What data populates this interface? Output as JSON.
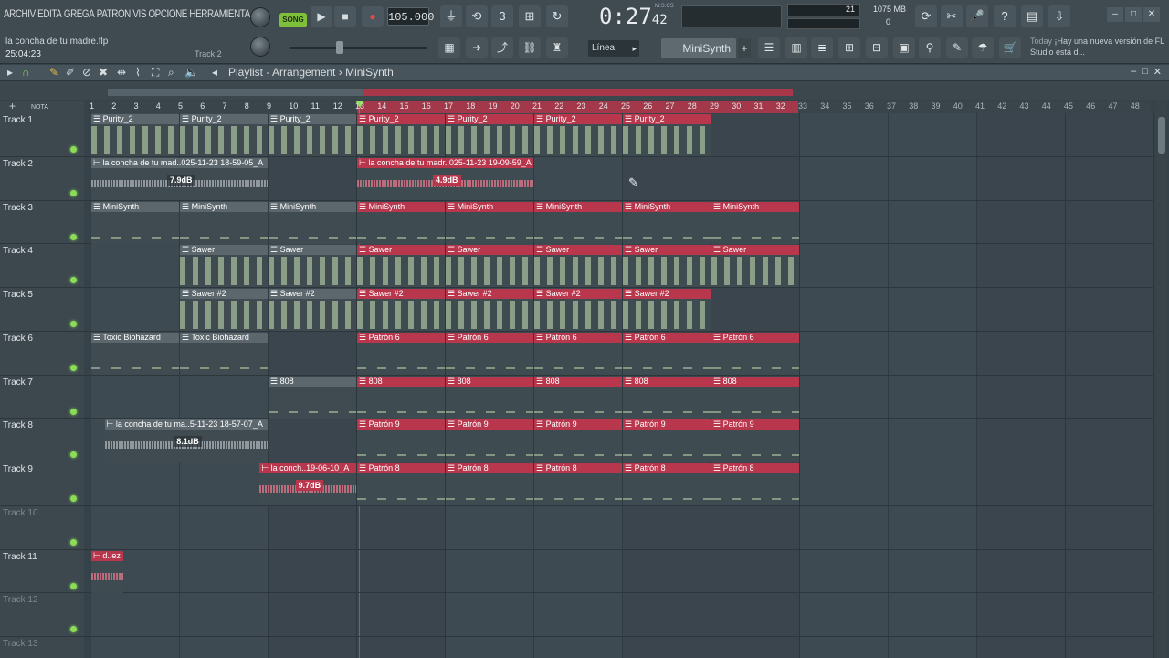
{
  "menu": [
    "ARCHIV",
    "EDITA",
    "GREGA",
    "PATRON",
    "VIS",
    "OPCIONE",
    "HERRAMIENTA"
  ],
  "project": {
    "name": "la concha de tu madre.flp",
    "elapsed": "25:04:23",
    "hint_track": "Track 2"
  },
  "transport": {
    "song_label": "SONG",
    "tempo": "105.000",
    "time_main": "0:27",
    "time_sub": "42",
    "time_unit": "M:S:CS"
  },
  "monitor": {
    "cpu": "21",
    "memory": "1075 MB",
    "polyphony": "0"
  },
  "toolbar": {
    "snap": "Línea",
    "channel": "MiniSynth",
    "add": "+"
  },
  "news": {
    "when": "Today",
    "text": "¡Hay una nueva versión de FL Studio está d..."
  },
  "playlist": {
    "title": "Playlist - Arrangement",
    "separator": "›",
    "pattern": "MiniSynth",
    "header_label": "NOTA"
  },
  "ruler": [
    1,
    2,
    3,
    4,
    5,
    6,
    7,
    8,
    9,
    10,
    11,
    12,
    13,
    14,
    15,
    16,
    17,
    18,
    19,
    20,
    21,
    22,
    23,
    24,
    25,
    26,
    27,
    28,
    29,
    30,
    31,
    32,
    33,
    34,
    35,
    36,
    37,
    38,
    39,
    40,
    41,
    42,
    43,
    44,
    45,
    46,
    47,
    48
  ],
  "tracks": [
    {
      "name": "Track 1",
      "active": true
    },
    {
      "name": "Track 2",
      "active": true
    },
    {
      "name": "Track 3",
      "active": true
    },
    {
      "name": "Track 4",
      "active": true
    },
    {
      "name": "Track 5",
      "active": true
    },
    {
      "name": "Track 6",
      "active": true
    },
    {
      "name": "Track 7",
      "active": true
    },
    {
      "name": "Track 8",
      "active": true
    },
    {
      "name": "Track 9",
      "active": true
    },
    {
      "name": "Track 10",
      "active": false
    },
    {
      "name": "Track 11",
      "active": true
    },
    {
      "name": "Track 12",
      "active": false
    },
    {
      "name": "Track 13",
      "active": false
    }
  ],
  "clips": [
    {
      "track": 1,
      "start": 1,
      "len": 4,
      "label": "Purity_2",
      "style": "grey",
      "kind": "notes"
    },
    {
      "track": 1,
      "start": 5,
      "len": 4,
      "label": "Purity_2",
      "style": "grey",
      "kind": "notes"
    },
    {
      "track": 1,
      "start": 9,
      "len": 4,
      "label": "Purity_2",
      "style": "grey",
      "kind": "notes"
    },
    {
      "track": 1,
      "start": 13,
      "len": 4,
      "label": "Purity_2",
      "style": "red",
      "kind": "notes"
    },
    {
      "track": 1,
      "start": 17,
      "len": 4,
      "label": "Purity_2",
      "style": "red",
      "kind": "notes"
    },
    {
      "track": 1,
      "start": 21,
      "len": 4,
      "label": "Purity_2",
      "style": "red",
      "kind": "notes"
    },
    {
      "track": 1,
      "start": 25,
      "len": 4,
      "label": "Purity_2",
      "style": "red",
      "kind": "notes"
    },
    {
      "track": 2,
      "start": 1,
      "len": 8,
      "label": "la concha de tu mad..025-11-23 18-59-05_A",
      "style": "grey",
      "kind": "audio",
      "gain": "7.9dB"
    },
    {
      "track": 2,
      "start": 13,
      "len": 8,
      "label": "la concha de tu madr..025-11-23 19-09-59_A",
      "style": "red",
      "kind": "audio",
      "gain": "4.9dB"
    },
    {
      "track": 3,
      "start": 1,
      "len": 4,
      "label": "MiniSynth",
      "style": "grey",
      "kind": "notes2"
    },
    {
      "track": 3,
      "start": 5,
      "len": 4,
      "label": "MiniSynth",
      "style": "grey",
      "kind": "notes2"
    },
    {
      "track": 3,
      "start": 9,
      "len": 4,
      "label": "MiniSynth",
      "style": "grey",
      "kind": "notes2"
    },
    {
      "track": 3,
      "start": 13,
      "len": 4,
      "label": "MiniSynth",
      "style": "red",
      "kind": "notes2"
    },
    {
      "track": 3,
      "start": 17,
      "len": 4,
      "label": "MiniSynth",
      "style": "red",
      "kind": "notes2"
    },
    {
      "track": 3,
      "start": 21,
      "len": 4,
      "label": "MiniSynth",
      "style": "red",
      "kind": "notes2"
    },
    {
      "track": 3,
      "start": 25,
      "len": 4,
      "label": "MiniSynth",
      "style": "red",
      "kind": "notes2"
    },
    {
      "track": 3,
      "start": 29,
      "len": 4,
      "label": "MiniSynth",
      "style": "red",
      "kind": "notes2"
    },
    {
      "track": 4,
      "start": 5,
      "len": 4,
      "label": "Sawer",
      "style": "grey",
      "kind": "notes"
    },
    {
      "track": 4,
      "start": 9,
      "len": 4,
      "label": "Sawer",
      "style": "grey",
      "kind": "notes"
    },
    {
      "track": 4,
      "start": 13,
      "len": 4,
      "label": "Sawer",
      "style": "red",
      "kind": "notes"
    },
    {
      "track": 4,
      "start": 17,
      "len": 4,
      "label": "Sawer",
      "style": "red",
      "kind": "notes"
    },
    {
      "track": 4,
      "start": 21,
      "len": 4,
      "label": "Sawer",
      "style": "red",
      "kind": "notes"
    },
    {
      "track": 4,
      "start": 25,
      "len": 4,
      "label": "Sawer",
      "style": "red",
      "kind": "notes"
    },
    {
      "track": 4,
      "start": 29,
      "len": 4,
      "label": "Sawer",
      "style": "red",
      "kind": "notes"
    },
    {
      "track": 5,
      "start": 5,
      "len": 4,
      "label": "Sawer #2",
      "style": "grey",
      "kind": "notes"
    },
    {
      "track": 5,
      "start": 9,
      "len": 4,
      "label": "Sawer #2",
      "style": "grey",
      "kind": "notes"
    },
    {
      "track": 5,
      "start": 13,
      "len": 4,
      "label": "Sawer #2",
      "style": "red",
      "kind": "notes"
    },
    {
      "track": 5,
      "start": 17,
      "len": 4,
      "label": "Sawer #2",
      "style": "red",
      "kind": "notes"
    },
    {
      "track": 5,
      "start": 21,
      "len": 4,
      "label": "Sawer #2",
      "style": "red",
      "kind": "notes"
    },
    {
      "track": 5,
      "start": 25,
      "len": 4,
      "label": "Sawer #2",
      "style": "red",
      "kind": "notes"
    },
    {
      "track": 6,
      "start": 1,
      "len": 4,
      "label": "Toxic Biohazard",
      "style": "grey",
      "kind": "notes2"
    },
    {
      "track": 6,
      "start": 5,
      "len": 4,
      "label": "Toxic Biohazard",
      "style": "grey",
      "kind": "notes2"
    },
    {
      "track": 6,
      "start": 13,
      "len": 4,
      "label": "Patrón 6",
      "style": "red",
      "kind": "notes2"
    },
    {
      "track": 6,
      "start": 17,
      "len": 4,
      "label": "Patrón 6",
      "style": "red",
      "kind": "notes2"
    },
    {
      "track": 6,
      "start": 21,
      "len": 4,
      "label": "Patrón 6",
      "style": "red",
      "kind": "notes2"
    },
    {
      "track": 6,
      "start": 25,
      "len": 4,
      "label": "Patrón 6",
      "style": "red",
      "kind": "notes2"
    },
    {
      "track": 6,
      "start": 29,
      "len": 4,
      "label": "Patrón 6",
      "style": "red",
      "kind": "notes2"
    },
    {
      "track": 7,
      "start": 9,
      "len": 4,
      "label": "808",
      "style": "grey",
      "kind": "notes2"
    },
    {
      "track": 7,
      "start": 13,
      "len": 4,
      "label": "808",
      "style": "red",
      "kind": "notes2"
    },
    {
      "track": 7,
      "start": 17,
      "len": 4,
      "label": "808",
      "style": "red",
      "kind": "notes2"
    },
    {
      "track": 7,
      "start": 21,
      "len": 4,
      "label": "808",
      "style": "red",
      "kind": "notes2"
    },
    {
      "track": 7,
      "start": 25,
      "len": 4,
      "label": "808",
      "style": "red",
      "kind": "notes2"
    },
    {
      "track": 7,
      "start": 29,
      "len": 4,
      "label": "808",
      "style": "red",
      "kind": "notes2"
    },
    {
      "track": 8,
      "start": 1.6,
      "len": 7.4,
      "label": "la concha de tu ma..5-11-23 18-57-07_A",
      "style": "grey",
      "kind": "audio",
      "gain": "8.1dB"
    },
    {
      "track": 8,
      "start": 13,
      "len": 4,
      "label": "Patrón 9",
      "style": "red",
      "kind": "notes2"
    },
    {
      "track": 8,
      "start": 17,
      "len": 4,
      "label": "Patrón 9",
      "style": "red",
      "kind": "notes2"
    },
    {
      "track": 8,
      "start": 21,
      "len": 4,
      "label": "Patrón 9",
      "style": "red",
      "kind": "notes2"
    },
    {
      "track": 8,
      "start": 25,
      "len": 4,
      "label": "Patrón 9",
      "style": "red",
      "kind": "notes2"
    },
    {
      "track": 8,
      "start": 29,
      "len": 4,
      "label": "Patrón 9",
      "style": "red",
      "kind": "notes2"
    },
    {
      "track": 9,
      "start": 8.6,
      "len": 4.4,
      "label": "la conch..19-06-10_A",
      "style": "red",
      "kind": "audio",
      "gain": "9.7dB"
    },
    {
      "track": 9,
      "start": 13,
      "len": 4,
      "label": "Patrón 8",
      "style": "red",
      "kind": "notes2"
    },
    {
      "track": 9,
      "start": 17,
      "len": 4,
      "label": "Patrón 8",
      "style": "red",
      "kind": "notes2"
    },
    {
      "track": 9,
      "start": 21,
      "len": 4,
      "label": "Patrón 8",
      "style": "red",
      "kind": "notes2"
    },
    {
      "track": 9,
      "start": 25,
      "len": 4,
      "label": "Patrón 8",
      "style": "red",
      "kind": "notes2"
    },
    {
      "track": 9,
      "start": 29,
      "len": 4,
      "label": "Patrón 8",
      "style": "red",
      "kind": "notes2"
    },
    {
      "track": 11,
      "start": 1,
      "len": 1.5,
      "label": "d..ez",
      "style": "red",
      "kind": "audio"
    }
  ]
}
